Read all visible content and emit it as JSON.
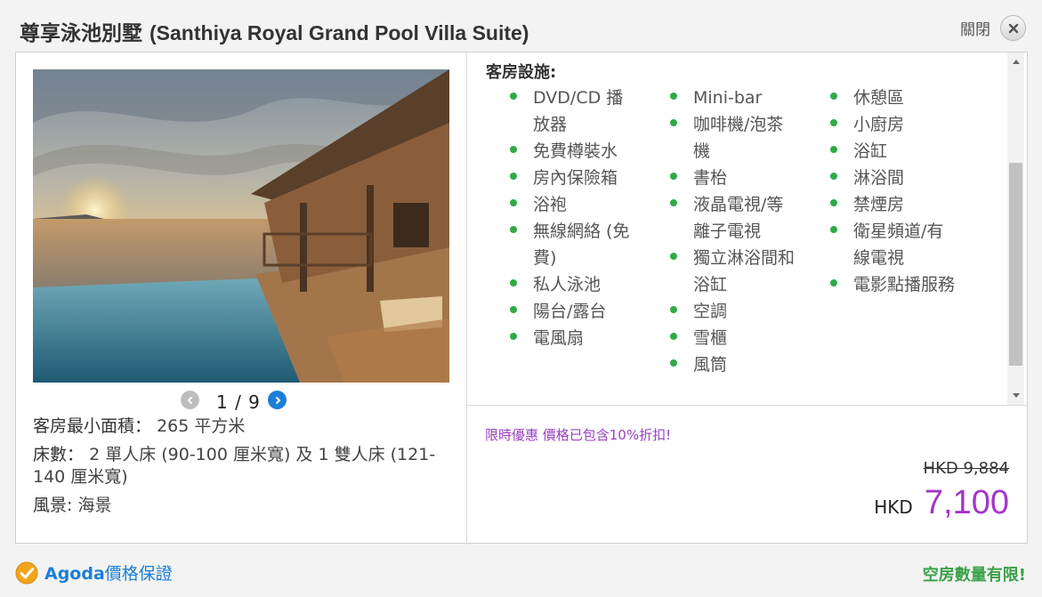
{
  "header": {
    "title_cn": "尊享泳池別墅",
    "title_en": "(Santhiya Royal Grand Pool Villa Suite)",
    "close_label": "關閉"
  },
  "gallery": {
    "counter": "1 / 9",
    "prev_icon": "chevron-left-icon",
    "next_icon": "chevron-right-icon"
  },
  "room_info": {
    "size_label": "客房最小面積：",
    "size_value": "265 平方米",
    "bed_label": "床數：",
    "bed_value": "2 單人床 (90-100 厘米寬) 及 1 雙人床 (121-140 厘米寬)",
    "view_label": "風景:",
    "view_value": "海景"
  },
  "amenities": {
    "title": "客房設施:",
    "columns": [
      [
        "DVD/CD 播放器",
        "免費樽裝水",
        "房內保險箱",
        "浴袍",
        "無線網絡 (免費)",
        "私人泳池",
        "陽台/露台",
        "電風扇"
      ],
      [
        "Mini-bar",
        "咖啡機/泡茶機",
        "書枱",
        "液晶電視/等離子電視",
        "獨立淋浴間和浴缸",
        "空調",
        "雪櫃",
        "風筒"
      ],
      [
        "休憩區",
        "小廚房",
        "浴缸",
        "淋浴間",
        "禁煙房",
        "衛星頻道/有線電視",
        "電影點播服務"
      ]
    ]
  },
  "pricing": {
    "promo": "限時優惠 價格已包含10%折扣!",
    "old_price": "HKD 9,884",
    "currency": "HKD",
    "price": "7,100"
  },
  "footer": {
    "guarantee_brand": "Agoda",
    "guarantee_text": "價格保證",
    "availability": "空房數量有限!"
  },
  "colors": {
    "accent_purple": "#a235c8",
    "link_blue": "#1c7fd6",
    "bullet_green": "#2eab45",
    "availability_green": "#3aa148"
  }
}
